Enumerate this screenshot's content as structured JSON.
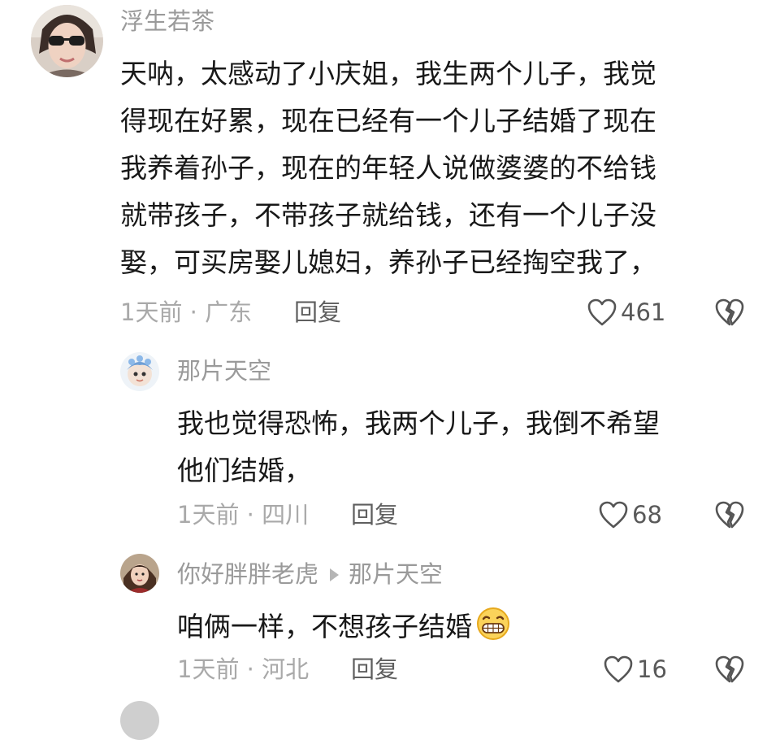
{
  "comment1": {
    "username": "浮生若茶",
    "lines": [
      "天呐，太感动了小庆姐，我生两个儿子，我觉",
      "得现在好累，现在已经有一个儿子结婚了现在",
      "我养着孙子，现在的年轻人说做婆婆的不给钱",
      "就带孩子，不带孩子就给钱，还有一个儿子没",
      "娶，可买房娶儿媳妇，养孙子已经掏空我了，"
    ],
    "meta": "1天前 · 广东",
    "reply_label": "回复",
    "likes": "461"
  },
  "comment2": {
    "username": "那片天空",
    "lines": [
      "我也觉得恐怖，我两个儿子，我倒不希望",
      "他们结婚，"
    ],
    "meta": "1天前 · 四川",
    "reply_label": "回复",
    "likes": "68"
  },
  "comment3": {
    "username": "你好胖胖老虎",
    "reply_to": "那片天空",
    "text": "咱俩一样，不想孩子结婚",
    "meta": "1天前 · 河北",
    "reply_label": "回复",
    "likes": "16"
  },
  "icons": {
    "like": "heart-outline-icon",
    "dislike": "broken-heart-icon",
    "reply_arrow": "triangle-right-icon",
    "emoji": "grinning-face-emoji"
  },
  "colors": {
    "text": "#181818",
    "muted": "#a9a9a9",
    "username": "#9a9a9a",
    "reply": "#5f5f5f"
  }
}
